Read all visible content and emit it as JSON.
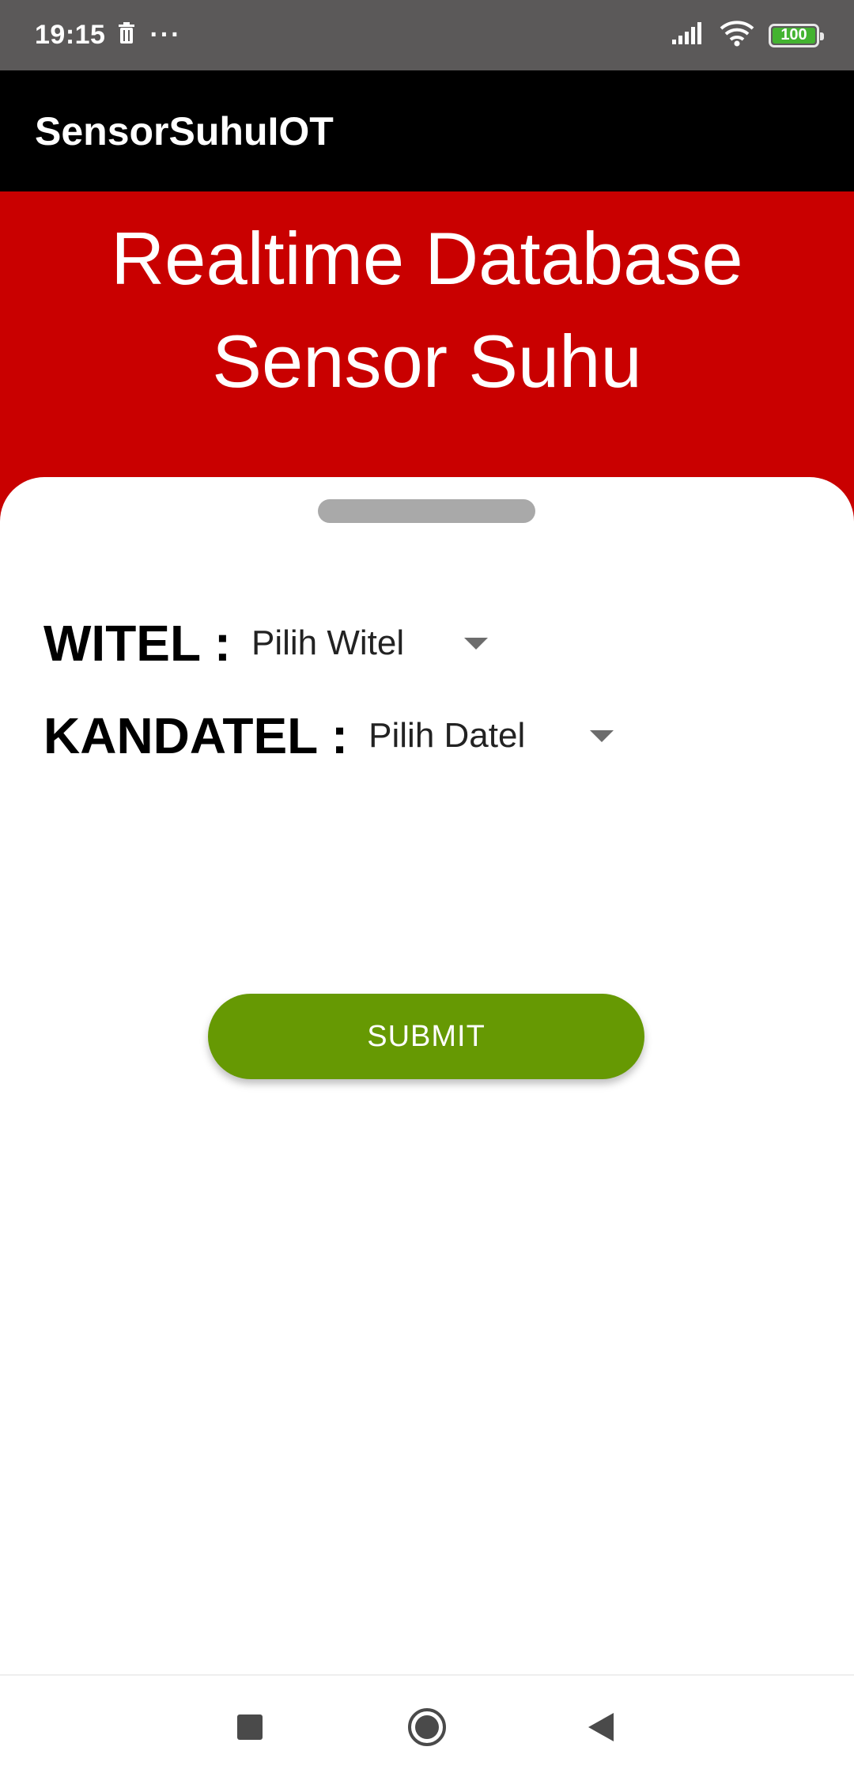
{
  "status_bar": {
    "time": "19:15",
    "dots": "···",
    "battery_level": "100",
    "icons": [
      "trash-icon",
      "signal-icon",
      "wifi-icon",
      "battery-icon"
    ]
  },
  "app_bar": {
    "title": "SensorSuhuIOT"
  },
  "header": {
    "line1": "Realtime Database",
    "line2": "Sensor Suhu"
  },
  "form": {
    "witel": {
      "label": "WITEL :",
      "value": "Pilih Witel"
    },
    "kandatel": {
      "label": "KANDATEL :",
      "value": "Pilih Datel"
    },
    "submit_label": "SUBMIT"
  },
  "navigation": {
    "buttons": [
      "recents-icon",
      "home-icon",
      "back-icon"
    ]
  },
  "colors": {
    "status_bar": "#5b5959",
    "app_bar": "#000000",
    "header": "#c90000",
    "submit": "#669903",
    "battery": "#43b330"
  }
}
